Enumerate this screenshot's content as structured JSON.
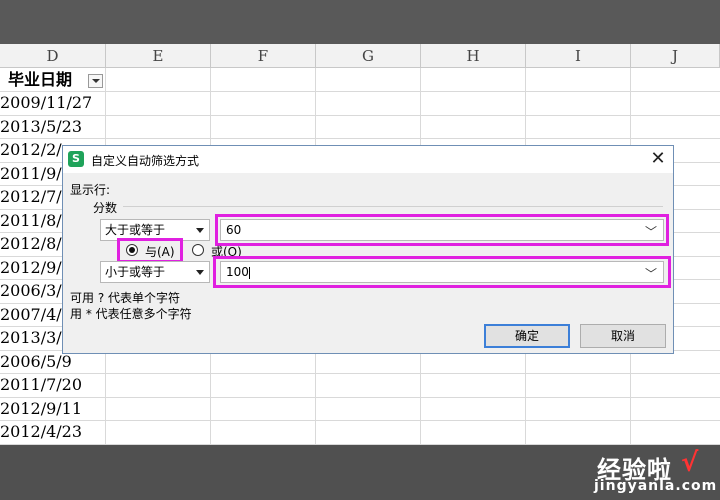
{
  "columns": [
    "D",
    "E",
    "F",
    "G",
    "H",
    "I",
    "J"
  ],
  "header_cell": "毕业日期",
  "dates": [
    "2009/11/27",
    "2013/5/23",
    "2012/2/",
    "2011/9/",
    "2012/7/",
    "2011/8/",
    "2012/8/",
    "2012/9/",
    "2006/3/",
    "2007/4/",
    "2013/3/",
    "2006/5/9",
    "2011/7/20",
    "2012/9/11",
    "2012/4/23"
  ],
  "dialog": {
    "title": "自定义自动筛选方式",
    "app_icon": "S",
    "close": "✕",
    "show_rows_label": "显示行:",
    "field_label": "分数",
    "cond1": {
      "operator": "大于或等于",
      "value": "60"
    },
    "logic": {
      "and_label": "与(A)",
      "or_label": "或(O)",
      "selected": "and"
    },
    "cond2": {
      "operator": "小于或等于",
      "value": "100"
    },
    "hint1": "可用 ? 代表单个字符",
    "hint2": "用 * 代表任意多个字符",
    "ok_label": "确定",
    "cancel_label": "取消"
  },
  "watermark": {
    "name": "经验啦",
    "check": "√",
    "url": "jingyanla.com"
  },
  "colors": {
    "highlight": "#e020e0",
    "accent": "#3c7fd8",
    "app_icon": "#1fa35a"
  }
}
